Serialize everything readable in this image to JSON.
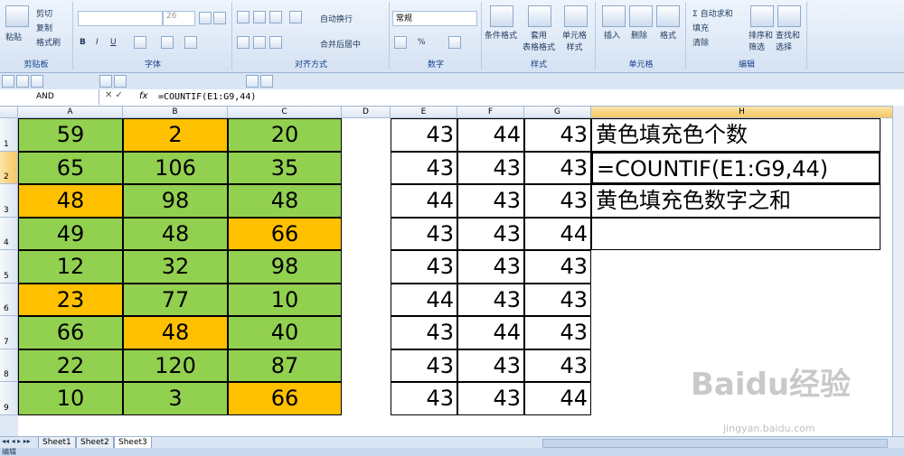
{
  "ribbon": {
    "clipboard": {
      "paste": "粘贴",
      "cut": "剪切",
      "copy": "复制",
      "format_painter": "格式刷",
      "label": "剪贴板"
    },
    "font": {
      "size": "26",
      "bold": "B",
      "italic": "I",
      "underline": "U",
      "label": "字体"
    },
    "alignment": {
      "wrap": "自动换行",
      "merge": "合并后居中",
      "label": "对齐方式"
    },
    "number": {
      "format": "常规",
      "percent": "%",
      "label": "数字"
    },
    "styles": {
      "conditional": "条件格式",
      "table": "套用\n表格格式",
      "cell": "单元格\n样式",
      "label": "样式"
    },
    "cells": {
      "insert": "插入",
      "delete": "删除",
      "format": "格式",
      "label": "单元格"
    },
    "editing": {
      "autosum": "自动求和",
      "fill": "填充",
      "clear": "清除",
      "sort": "排序和\n筛选",
      "find": "查找和\n选择",
      "label": "编辑"
    }
  },
  "formula_bar": {
    "name_box": "AND",
    "fx": "fx",
    "formula": "=COUNTIF(E1:G9,44)"
  },
  "columns": [
    "A",
    "B",
    "C",
    "D",
    "E",
    "F",
    "G",
    "H"
  ],
  "rows": [
    "1",
    "2",
    "3",
    "4",
    "5",
    "6",
    "7",
    "8",
    "9"
  ],
  "colors": {
    "green": "#92d050",
    "yellow": "#ffc000"
  },
  "table_abc": [
    [
      {
        "v": "59",
        "c": "green"
      },
      {
        "v": "2",
        "c": "yellow"
      },
      {
        "v": "20",
        "c": "green"
      }
    ],
    [
      {
        "v": "65",
        "c": "green"
      },
      {
        "v": "106",
        "c": "green"
      },
      {
        "v": "35",
        "c": "green"
      }
    ],
    [
      {
        "v": "48",
        "c": "yellow"
      },
      {
        "v": "98",
        "c": "green"
      },
      {
        "v": "48",
        "c": "green"
      }
    ],
    [
      {
        "v": "49",
        "c": "green"
      },
      {
        "v": "48",
        "c": "green"
      },
      {
        "v": "66",
        "c": "yellow"
      }
    ],
    [
      {
        "v": "12",
        "c": "green"
      },
      {
        "v": "32",
        "c": "green"
      },
      {
        "v": "98",
        "c": "green"
      }
    ],
    [
      {
        "v": "23",
        "c": "yellow"
      },
      {
        "v": "77",
        "c": "green"
      },
      {
        "v": "10",
        "c": "green"
      }
    ],
    [
      {
        "v": "66",
        "c": "green"
      },
      {
        "v": "48",
        "c": "yellow"
      },
      {
        "v": "40",
        "c": "green"
      }
    ],
    [
      {
        "v": "22",
        "c": "green"
      },
      {
        "v": "120",
        "c": "green"
      },
      {
        "v": "87",
        "c": "green"
      }
    ],
    [
      {
        "v": "10",
        "c": "green"
      },
      {
        "v": "3",
        "c": "green"
      },
      {
        "v": "66",
        "c": "yellow"
      }
    ]
  ],
  "table_efg": [
    [
      "43",
      "44",
      "43"
    ],
    [
      "43",
      "43",
      "43"
    ],
    [
      "44",
      "43",
      "43"
    ],
    [
      "43",
      "43",
      "44"
    ],
    [
      "43",
      "43",
      "43"
    ],
    [
      "44",
      "43",
      "43"
    ],
    [
      "43",
      "44",
      "43"
    ],
    [
      "43",
      "43",
      "43"
    ],
    [
      "43",
      "43",
      "44"
    ]
  ],
  "col_h": [
    "黄色填充色个数",
    "=COUNTIF(E1:G9,44)",
    "黄色填充色数字之和",
    ""
  ],
  "sheets": [
    "Sheet1",
    "Sheet2",
    "Sheet3"
  ],
  "status": {
    "mode": "编辑"
  },
  "watermark": {
    "main": "Baidu经验",
    "sub": "jingyan.baidu.com"
  }
}
